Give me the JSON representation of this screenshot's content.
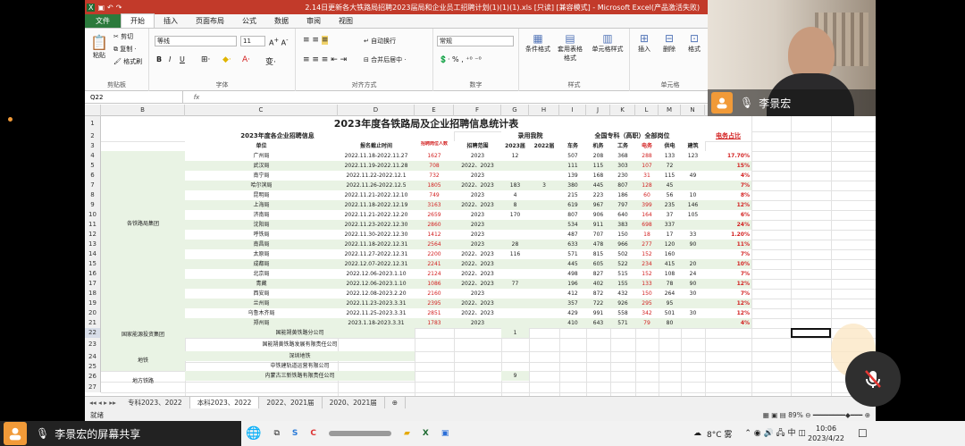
{
  "window_title": "2.14日更新各大铁路局招聘2023届局和企业员工招聘计划(1)(1)(1).xls [只读] [兼容模式] - Microsoft Excel(产品激活失败)",
  "menu_tabs": [
    "文件",
    "开始",
    "插入",
    "页面布局",
    "公式",
    "数据",
    "审阅",
    "视图"
  ],
  "ribbon": {
    "clipboard": {
      "paste": "粘贴",
      "cut": "剪切",
      "copy": "复制 ·",
      "painter": "格式刷",
      "label": "剪贴板"
    },
    "font": {
      "name": "等线",
      "size": "11",
      "label": "字体"
    },
    "align": {
      "wrap": "自动换行",
      "merge": "合并后居中 ·",
      "label": "对齐方式"
    },
    "number": {
      "format": "常规",
      "label": "数字"
    },
    "styles": {
      "cond": "条件格式",
      "table": "套用表格格式",
      "cell": "单元格样式",
      "label": "样式"
    },
    "cells": {
      "insert": "插入",
      "delete": "删除",
      "format": "格式",
      "label": "单元格"
    }
  },
  "name_box": "Q22",
  "fx": "fx",
  "columns": [
    "B",
    "C",
    "D",
    "E",
    "F",
    "G",
    "H",
    "I",
    "J",
    "K",
    "L",
    "M",
    "N",
    "O",
    "P",
    "Q"
  ],
  "sheet": {
    "title": "2023年度各铁路局及企业招聘信息统计表",
    "h_info": "2023年度各企业招聘信息",
    "h_luyong": "录用我院",
    "h_zhuanke": "全国专科（高职）全部岗位",
    "h_dianwu": "电务占比",
    "h3": [
      "单位",
      "报名截止时间",
      "招聘岗位人数",
      "招聘范围",
      "2023届",
      "2022届",
      "车务",
      "机务",
      "工务",
      "电务",
      "供电",
      "建筑"
    ],
    "group1": "各铁路局集团",
    "rows": [
      {
        "r": "4",
        "unit": "广州局",
        "date": "2022.11.18-2022.11.27",
        "num": "1627",
        "range": "2023",
        "g": "12",
        "h": "",
        "i": "507",
        "j": "208",
        "k": "368",
        "l": "288",
        "m": "133",
        "n": "123",
        "o": "17.70%"
      },
      {
        "r": "5",
        "unit": "武汉局",
        "date": "2022.11.19-2022.11.28",
        "num": "708",
        "range": "2022、2023",
        "g": "",
        "h": "",
        "i": "111",
        "j": "115",
        "k": "303",
        "l": "107",
        "m": "72",
        "n": "",
        "o": "15%"
      },
      {
        "r": "6",
        "unit": "南宁局",
        "date": "2022.11.22-2022.12.1",
        "num": "732",
        "range": "2023",
        "g": "",
        "h": "",
        "i": "139",
        "j": "168",
        "k": "230",
        "l": "31",
        "m": "115",
        "n": "49",
        "o": "4%"
      },
      {
        "r": "7",
        "unit": "哈尔滨局",
        "date": "2022.11.26-2022.12.5",
        "num": "1805",
        "range": "2022、2023",
        "g": "183",
        "h": "3",
        "i": "380",
        "j": "445",
        "k": "807",
        "l": "128",
        "m": "45",
        "n": "",
        "o": "7%"
      },
      {
        "r": "8",
        "unit": "昆明局",
        "date": "2022.11.21-2022.12.10",
        "num": "749",
        "range": "2023",
        "g": "4",
        "h": "",
        "i": "215",
        "j": "223",
        "k": "186",
        "l": "60",
        "m": "56",
        "n": "10",
        "o": "8%"
      },
      {
        "r": "9",
        "unit": "上海局",
        "date": "2022.11.18-2022.12.19",
        "num": "3163",
        "range": "2022、2023",
        "g": "8",
        "h": "",
        "i": "619",
        "j": "967",
        "k": "797",
        "l": "399",
        "m": "235",
        "n": "146",
        "o": "12%"
      },
      {
        "r": "10",
        "unit": "济南局",
        "date": "2022.11.21-2022.12.20",
        "num": "2659",
        "range": "2023",
        "g": "170",
        "h": "",
        "i": "807",
        "j": "906",
        "k": "640",
        "l": "164",
        "m": "37",
        "n": "105",
        "o": "6%"
      },
      {
        "r": "11",
        "unit": "沈阳局",
        "date": "2022.11.23-2022.12.30",
        "num": "2860",
        "range": "2023",
        "g": "",
        "h": "",
        "i": "534",
        "j": "911",
        "k": "383",
        "l": "698",
        "m": "337",
        "n": "",
        "o": "24%"
      },
      {
        "r": "12",
        "unit": "呼铁局",
        "date": "2022.11.30-2022.12.30",
        "num": "1412",
        "range": "2023",
        "g": "",
        "h": "",
        "i": "487",
        "j": "707",
        "k": "150",
        "l": "18",
        "m": "17",
        "n": "33",
        "o": "1.20%"
      },
      {
        "r": "13",
        "unit": "南昌局",
        "date": "2022.11.18-2022.12.31",
        "num": "2564",
        "range": "2023",
        "g": "28",
        "h": "",
        "i": "633",
        "j": "478",
        "k": "966",
        "l": "277",
        "m": "120",
        "n": "90",
        "o": "11%"
      },
      {
        "r": "14",
        "unit": "太原局",
        "date": "2022.11.27-2022.12.31",
        "num": "2200",
        "range": "2022、2023",
        "g": "116",
        "h": "",
        "i": "571",
        "j": "815",
        "k": "502",
        "l": "152",
        "m": "160",
        "n": "",
        "o": "7%"
      },
      {
        "r": "15",
        "unit": "成都局",
        "date": "2022.12.07-2022.12.31",
        "num": "2241",
        "range": "2022、2023",
        "g": "",
        "h": "",
        "i": "445",
        "j": "605",
        "k": "522",
        "l": "234",
        "m": "415",
        "n": "20",
        "o": "10%"
      },
      {
        "r": "16",
        "unit": "北京局",
        "date": "2022.12.06-2023.1.10",
        "num": "2124",
        "range": "2022、2023",
        "g": "",
        "h": "",
        "i": "498",
        "j": "827",
        "k": "515",
        "l": "152",
        "m": "108",
        "n": "24",
        "o": "7%"
      },
      {
        "r": "17",
        "unit": "青藏",
        "date": "2022.12.06-2023.1.10",
        "num": "1086",
        "range": "2022、2023",
        "g": "77",
        "h": "",
        "i": "196",
        "j": "402",
        "k": "155",
        "l": "133",
        "m": "78",
        "n": "90",
        "o": "12%"
      },
      {
        "r": "18",
        "unit": "西安局",
        "date": "2022.12.08-2023.2.20",
        "num": "2160",
        "range": "2023",
        "g": "",
        "h": "",
        "i": "412",
        "j": "872",
        "k": "432",
        "l": "150",
        "m": "264",
        "n": "30",
        "o": "7%"
      },
      {
        "r": "19",
        "unit": "兰州局",
        "date": "2022.11.23-2023.3.31",
        "num": "2395",
        "range": "2022、2023",
        "g": "",
        "h": "",
        "i": "357",
        "j": "722",
        "k": "926",
        "l": "295",
        "m": "95",
        "n": "",
        "o": "12%"
      },
      {
        "r": "20",
        "unit": "乌鲁木齐局",
        "date": "2022.11.25-2023.3.31",
        "num": "2851",
        "range": "2022、2023",
        "g": "",
        "h": "",
        "i": "429",
        "j": "991",
        "k": "558",
        "l": "342",
        "m": "501",
        "n": "30",
        "o": "12%"
      },
      {
        "r": "21",
        "unit": "郑州局",
        "date": "2023.1.18-2023.3.31",
        "num": "1783",
        "range": "2023",
        "g": "",
        "h": "",
        "i": "410",
        "j": "643",
        "k": "571",
        "l": "79",
        "m": "80",
        "n": "",
        "o": "4%"
      }
    ],
    "group2": "国家能源投资集团",
    "r22": "国能朔黄铁路分公司",
    "r22g": "1",
    "r23": "国能朔黄铁路发展有限责任公司",
    "group3": "地铁",
    "r24": "深圳地铁",
    "r25": "中铁建轨道运营有限公司",
    "group4": "地方铁路",
    "r26": "内蒙古三新铁路有限责任公司",
    "r26g": "9"
  },
  "sheet_tabs": [
    "专科2023、2022",
    "本科2023、2022",
    "2022、2021届",
    "2020、2021届"
  ],
  "status": {
    "left": "就绪",
    "zoom": "89%"
  },
  "video": {
    "name": "李景宏"
  },
  "share": {
    "label": "李景宏的屏幕共享"
  },
  "taskbar": {
    "weather": "8°C 雾",
    "time": "10:06",
    "date": "2023/4/22"
  }
}
